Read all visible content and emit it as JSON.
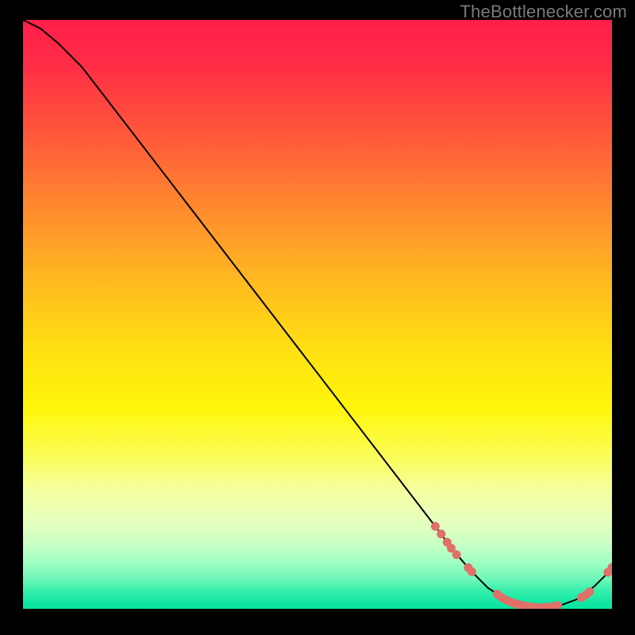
{
  "attribution": "TheBottlenecker.com",
  "colors": {
    "line": "#000000",
    "marker": "#e07068",
    "bg_top": "#ff1e4a",
    "bg_bottom": "#07e39f"
  },
  "chart_data": {
    "type": "line",
    "title": "",
    "xlabel": "",
    "ylabel": "",
    "xlim": [
      0,
      100
    ],
    "ylim": [
      0,
      100
    ],
    "grid": false,
    "legend": false,
    "series": [
      {
        "name": "bottleneck-curve",
        "x": [
          0,
          3,
          6,
          10,
          15,
          20,
          25,
          30,
          35,
          40,
          45,
          50,
          55,
          60,
          65,
          70,
          73,
          76,
          79,
          82,
          85,
          88,
          91,
          94,
          97,
          100
        ],
        "y": [
          100,
          98.5,
          96,
          92,
          85.5,
          79,
          72.5,
          66,
          59.5,
          53,
          46.5,
          40,
          33.5,
          27,
          20.5,
          14,
          10,
          6.5,
          3.5,
          1.6,
          0.6,
          0.2,
          0.5,
          1.6,
          3.8,
          6.8
        ]
      }
    ],
    "markers": [
      {
        "name": "highlight-points",
        "points": [
          {
            "x": 70.0,
            "y": 14.0
          },
          {
            "x": 71.0,
            "y": 12.7
          },
          {
            "x": 72.0,
            "y": 11.3
          },
          {
            "x": 72.7,
            "y": 10.3
          },
          {
            "x": 73.6,
            "y": 9.2
          },
          {
            "x": 75.6,
            "y": 7.0
          },
          {
            "x": 76.2,
            "y": 6.3
          },
          {
            "x": 80.5,
            "y": 2.5
          },
          {
            "x": 81.3,
            "y": 1.9
          },
          {
            "x": 82.0,
            "y": 1.5
          },
          {
            "x": 82.7,
            "y": 1.2
          },
          {
            "x": 83.4,
            "y": 0.95
          },
          {
            "x": 84.2,
            "y": 0.72
          },
          {
            "x": 84.9,
            "y": 0.56
          },
          {
            "x": 85.7,
            "y": 0.42
          },
          {
            "x": 86.4,
            "y": 0.32
          },
          {
            "x": 87.1,
            "y": 0.25
          },
          {
            "x": 87.9,
            "y": 0.21
          },
          {
            "x": 88.6,
            "y": 0.24
          },
          {
            "x": 89.3,
            "y": 0.3
          },
          {
            "x": 90.1,
            "y": 0.4
          },
          {
            "x": 90.8,
            "y": 0.55
          },
          {
            "x": 94.8,
            "y": 1.9
          },
          {
            "x": 95.6,
            "y": 2.4
          },
          {
            "x": 96.2,
            "y": 2.9
          },
          {
            "x": 99.3,
            "y": 6.2
          },
          {
            "x": 100.0,
            "y": 7.0
          }
        ]
      }
    ]
  }
}
